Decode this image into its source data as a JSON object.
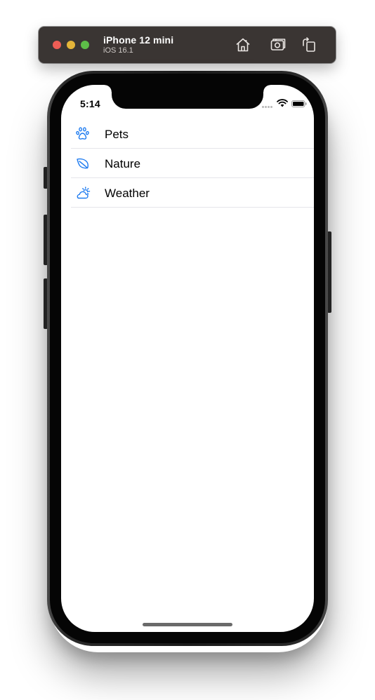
{
  "window": {
    "device_name": "iPhone 12 mini",
    "os_version": "iOS 16.1",
    "controls": {
      "close_icon": "close-window-icon",
      "minimize_icon": "minimize-window-icon",
      "zoom_icon": "zoom-window-icon"
    },
    "toolbar": [
      {
        "icon": "home-icon"
      },
      {
        "icon": "screenshot-icon"
      },
      {
        "icon": "rotate-icon"
      }
    ]
  },
  "status_bar": {
    "time": "5:14",
    "icons": [
      "cellular-signal-icon",
      "wifi-icon",
      "battery-icon"
    ]
  },
  "list": {
    "items": [
      {
        "label": "Pets",
        "icon": "pawprint-icon"
      },
      {
        "label": "Nature",
        "icon": "leaf-icon"
      },
      {
        "label": "Weather",
        "icon": "cloud-sun-icon"
      }
    ]
  },
  "colors": {
    "accent": "#1e7bf0",
    "titlebar": "#3a3533",
    "separator": "#e5e5ea"
  }
}
